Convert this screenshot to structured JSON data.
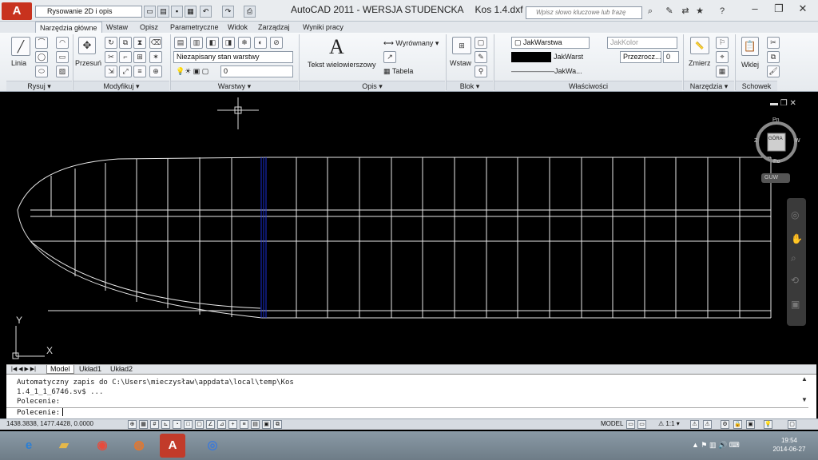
{
  "titlebar": {
    "app_button": "A",
    "workspace": "Rysowanie 2D i opis",
    "title": "AutoCAD 2011 - WERSJA STUDENCKA",
    "filename": "Kos 1.4.dxf",
    "search_placeholder": "Wpisz słowo kluczowe lub frazę",
    "minimize": "–",
    "restore": "❐",
    "close": "✕"
  },
  "tabs": [
    "Narzędzia główne",
    "Wstaw",
    "Opisz",
    "Parametryczne",
    "Widok",
    "Zarządzaj",
    "Wyniki pracy"
  ],
  "ribbon": {
    "line_label": "Linia",
    "move_label": "Przesuń",
    "layer_state": "Niezapisany stan warstwy",
    "layer_current": "0",
    "text_big": "A",
    "text_label": "Tekst wielowierszowy",
    "align_label": "Wyrównany",
    "table_label": "Tabela",
    "insert_label": "Wstaw",
    "color_value": "JakWarstwa",
    "color2": "JakKolor",
    "linetype_value": "JakWarst",
    "lineweight_value": "JakWa...",
    "transparency_label": "Przezrocz...",
    "transparency_value": "0",
    "measure_label": "Zmierz",
    "paste_label": "Wklej",
    "panels": [
      "Rysuj ▾",
      "Modyfikuj ▾",
      "Warstwy ▾",
      "Opis ▾",
      "Blok ▾",
      "Właściwości",
      "Narzędzia ▾",
      "Schowek"
    ]
  },
  "viewcube": {
    "top": "GÓRA",
    "north": "Pn",
    "south": "Po",
    "east": "W",
    "west": "Z",
    "ucs": "GUW"
  },
  "axes": {
    "y": "Y",
    "x": "X"
  },
  "layout_tabs": [
    "Model",
    "Układ1",
    "Układ2"
  ],
  "command": {
    "line1": "Automatyczny zapis do C:\\Users\\mieczysław\\appdata\\local\\temp\\Kos",
    "line2": "1.4_1_1_6746.sv$ ...",
    "line3": "Polecenie:",
    "prompt": "Polecenie:"
  },
  "status": {
    "coords": "1438.3838, 1477.4428, 0.0000",
    "model": "MODEL",
    "scale": "1:1 ▾"
  },
  "taskbar": {
    "time": "19:54",
    "date": "2014-06-27"
  }
}
